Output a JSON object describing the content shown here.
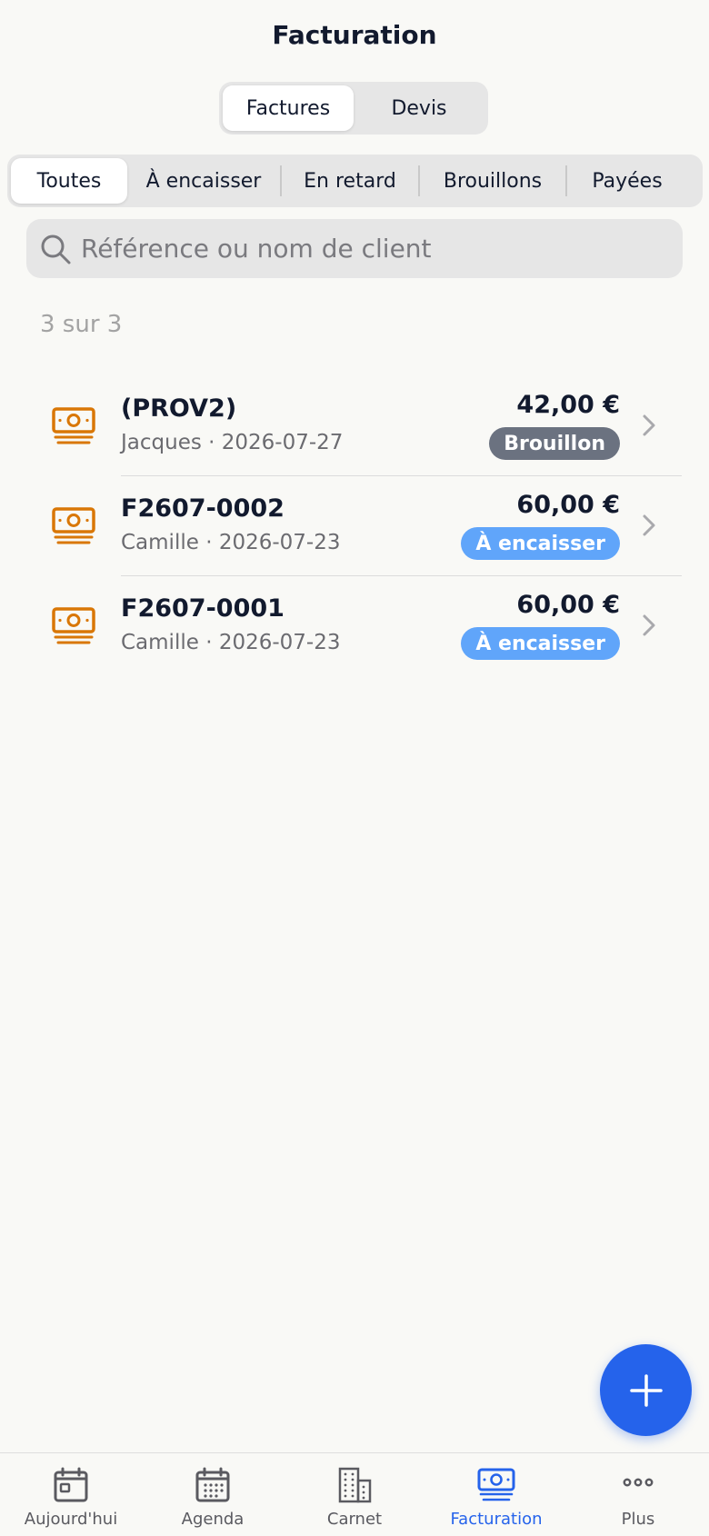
{
  "header": {
    "title": "Facturation"
  },
  "segment": {
    "options": [
      "Factures",
      "Devis"
    ],
    "selected": "Factures"
  },
  "filters": {
    "items": [
      "Toutes",
      "À encaisser",
      "En retard",
      "Brouillons",
      "Payées"
    ],
    "selected": "Toutes"
  },
  "search": {
    "placeholder": "Référence ou nom de client",
    "value": ""
  },
  "count_label": "3 sur 3",
  "invoices": [
    {
      "ref": "(PROV2)",
      "meta": "Jacques · 2026-07-27",
      "amount": "42,00 €",
      "status": "Brouillon",
      "status_color": "#6b7280"
    },
    {
      "ref": "F2607-0002",
      "meta": "Camille · 2026-07-23",
      "amount": "60,00 €",
      "status": "À encaisser",
      "status_color": "#60a5fa"
    },
    {
      "ref": "F2607-0001",
      "meta": "Camille · 2026-07-23",
      "amount": "60,00 €",
      "status": "À encaisser",
      "status_color": "#60a5fa"
    }
  ],
  "icons": {
    "invoice_row": "banknote-icon",
    "fab": "plus-icon",
    "search": "search-icon",
    "chevron": "chevron-right-icon"
  },
  "colors": {
    "accent": "#2563eb",
    "money_icon": "#d97706"
  },
  "tabbar": {
    "items": [
      {
        "label": "Aujourd'hui",
        "icon": "calendar-day-icon"
      },
      {
        "label": "Agenda",
        "icon": "calendar-grid-icon"
      },
      {
        "label": "Carnet",
        "icon": "building-icon"
      },
      {
        "label": "Facturation",
        "icon": "banknote-icon"
      },
      {
        "label": "Plus",
        "icon": "more-icon"
      }
    ],
    "active": "Facturation"
  }
}
